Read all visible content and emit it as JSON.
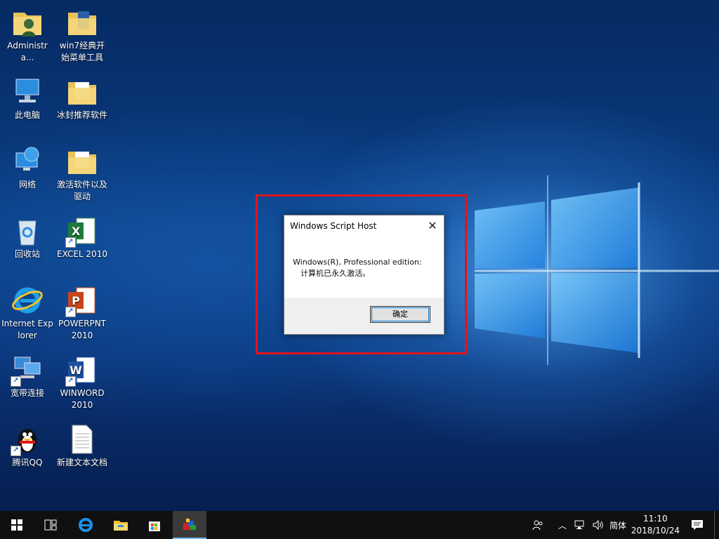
{
  "desktop": {
    "icons": [
      {
        "label": "Administra..."
      },
      {
        "label": "此电脑"
      },
      {
        "label": "网络"
      },
      {
        "label": "回收站"
      },
      {
        "label": "Internet Explorer"
      },
      {
        "label": "宽带连接"
      },
      {
        "label": "腾讯QQ"
      },
      {
        "label": "win7经典开始菜单工具"
      },
      {
        "label": "冰封推荐软件"
      },
      {
        "label": "激活软件以及驱动"
      },
      {
        "label": "EXCEL 2010"
      },
      {
        "label": "POWERPNT 2010"
      },
      {
        "label": "WINWORD 2010"
      },
      {
        "label": "新建文本文档"
      }
    ]
  },
  "dialog": {
    "title": "Windows Script Host",
    "message_line1": "Windows(R), Professional edition:",
    "message_line2": "计算机已永久激活。",
    "ok_label": "确定"
  },
  "taskbar": {
    "ime_label": "简体",
    "time": "11:10",
    "date": "2018/10/24"
  },
  "colors": {
    "highlight_border": "#e0141e",
    "taskbar_bg": "#101010",
    "accent": "#0078d7"
  }
}
